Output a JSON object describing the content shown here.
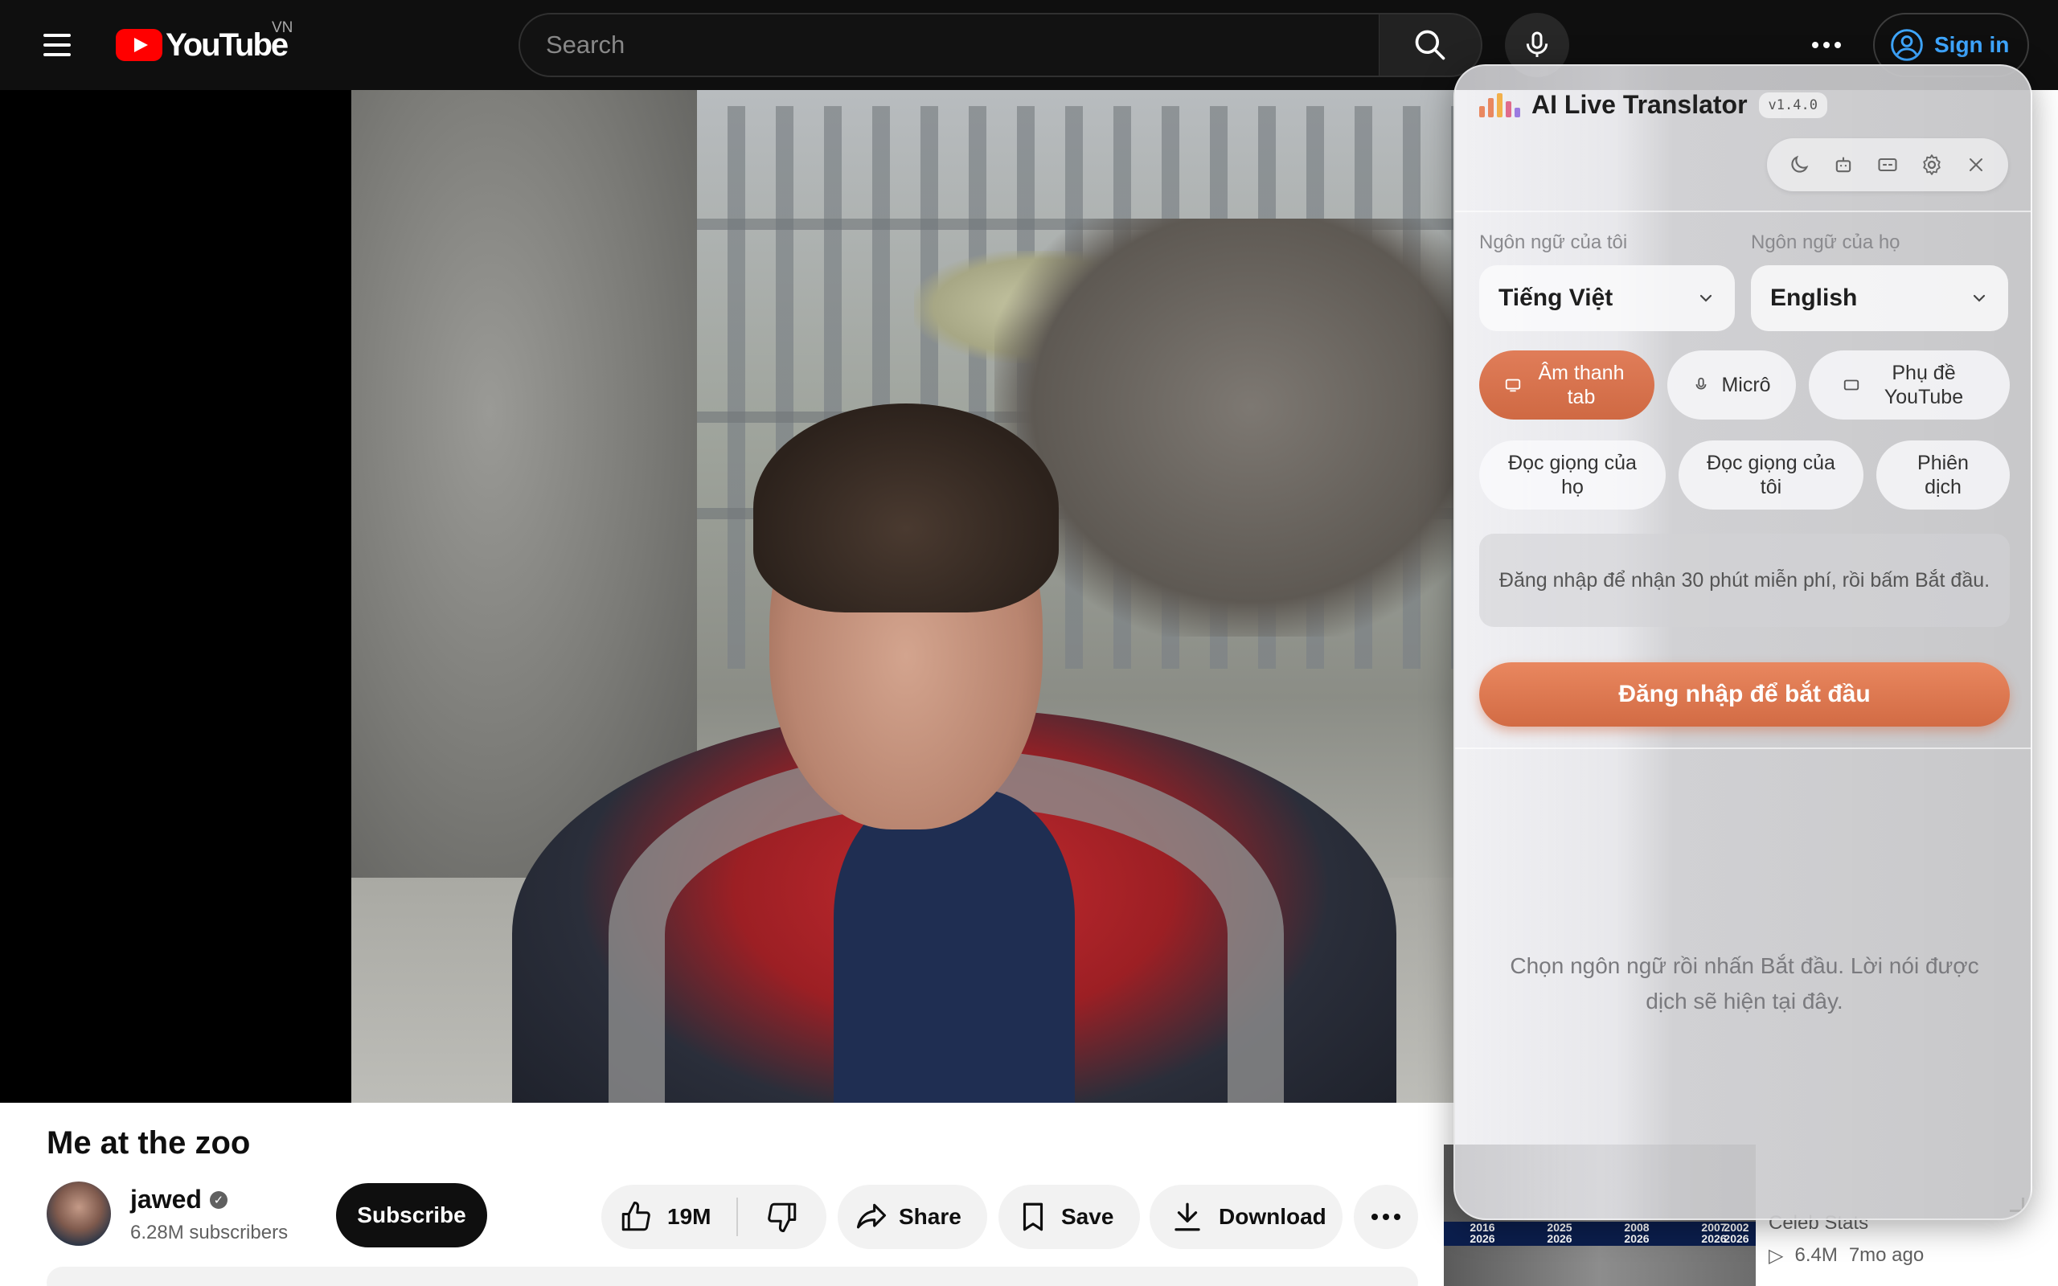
{
  "masthead": {
    "logo_text": "YouTube",
    "country_code": "VN",
    "search_placeholder": "Search",
    "signin_label": "Sign in"
  },
  "video": {
    "title": "Me at the zoo",
    "channel": "jawed",
    "subscribers": "6.28M subscribers",
    "subscribe_label": "Subscribe",
    "like_count": "19M",
    "share_label": "Share",
    "save_label": "Save",
    "download_label": "Download"
  },
  "recommended": {
    "channel": "Celeb Stats",
    "views": "6.4M",
    "age": "7mo ago",
    "thumb_years": [
      "2016\n2026",
      "2025\n2026",
      "2008\n2026",
      "2007\n2026",
      "2002\n2026"
    ]
  },
  "translator": {
    "title": "AI Live Translator",
    "version": "v1.4.0",
    "my_language_label": "Ngôn ngữ của tôi",
    "their_language_label": "Ngôn ngữ của họ",
    "my_language": "Tiếng Việt",
    "their_language": "English",
    "modes": [
      "Âm thanh tab",
      "Micrô",
      "Phụ đề YouTube"
    ],
    "actions": [
      "Đọc giọng của họ",
      "Đọc giọng của tôi",
      "Phiên dịch"
    ],
    "info": "Đăng nhập để nhận 30 phút miễn phí, rồi bấm Bắt đầu.",
    "login_button": "Đăng nhập để bắt đầu",
    "hint": "Chọn ngôn ngữ rồi nhấn Bắt đầu. Lời nói được dịch sẽ hiện tại đây.",
    "accent_color": "#d9714b",
    "toolbar_icons": [
      "moon-icon",
      "robot-icon",
      "caption-icon",
      "gear-icon",
      "close-icon"
    ]
  }
}
